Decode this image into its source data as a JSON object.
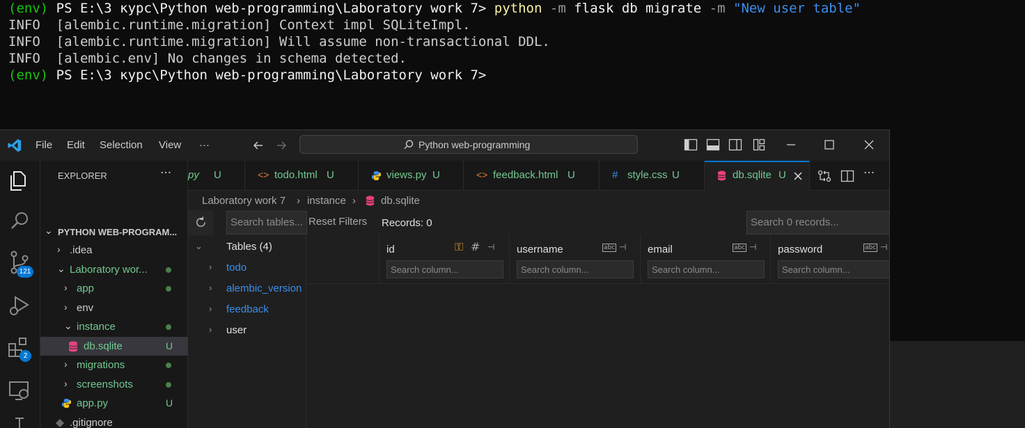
{
  "terminal": {
    "lines": [
      {
        "prefix": "(env)",
        "path": " PS E:\\3 курс\\Python web-programming\\Laboratory work 7> ",
        "cmd": "python",
        "flag1": " -m ",
        "args": "flask db migrate",
        "flag2": " -m ",
        "msg": "\"New user table\""
      },
      {
        "text": "INFO  [alembic.runtime.migration] Context impl SQLiteImpl."
      },
      {
        "text": "INFO  [alembic.runtime.migration] Will assume non-transactional DDL."
      },
      {
        "text": "INFO  [alembic.env] No changes in schema detected."
      },
      {
        "prefix": "(env)",
        "path": " PS E:\\3 курс\\Python web-programming\\Laboratory work 7>"
      }
    ]
  },
  "titlebar": {
    "menus": [
      "File",
      "Edit",
      "Selection",
      "View",
      "···"
    ],
    "search": "Python web-programming"
  },
  "activity": {
    "scm_badge": "121",
    "extensions_badge": "2"
  },
  "sidebar": {
    "title": "EXPLORER",
    "more": "···",
    "root": "PYTHON WEB-PROGRAM...",
    "items": [
      {
        "label": ".idea"
      },
      {
        "label": "Laboratory wor..."
      },
      {
        "label": "app"
      },
      {
        "label": "env"
      },
      {
        "label": "instance"
      },
      {
        "label": "db.sqlite",
        "status": "U"
      },
      {
        "label": "migrations"
      },
      {
        "label": "screenshots"
      },
      {
        "label": "app.py",
        "status": "U"
      },
      {
        "label": ".gitignore"
      }
    ]
  },
  "tabs": [
    {
      "label": "py",
      "status": "U"
    },
    {
      "label": "todo.html",
      "status": "U"
    },
    {
      "label": "views.py",
      "status": "U"
    },
    {
      "label": "feedback.html",
      "status": "U"
    },
    {
      "label": "style.css",
      "status": "U"
    },
    {
      "label": "db.sqlite",
      "status": "U"
    }
  ],
  "breadcrumb": [
    "Laboratory work 7",
    "instance",
    "db.sqlite"
  ],
  "db": {
    "search_tables_placeholder": "Search tables...",
    "reset_filters": "Reset Filters",
    "records": "Records: 0",
    "search_records_placeholder": "Search 0 records...",
    "tables_header": "Tables (4)",
    "tables": [
      "todo",
      "alembic_version",
      "feedback",
      "user"
    ],
    "columns": [
      {
        "name": "id",
        "placeholder": "Search column..."
      },
      {
        "name": "username",
        "placeholder": "Search column..."
      },
      {
        "name": "email",
        "placeholder": "Search column..."
      },
      {
        "name": "password",
        "placeholder": "Search column..."
      }
    ]
  },
  "colors": {
    "accent": "#0078d4",
    "untracked_green": "#73c991",
    "sqlite_red": "#e8417b"
  }
}
